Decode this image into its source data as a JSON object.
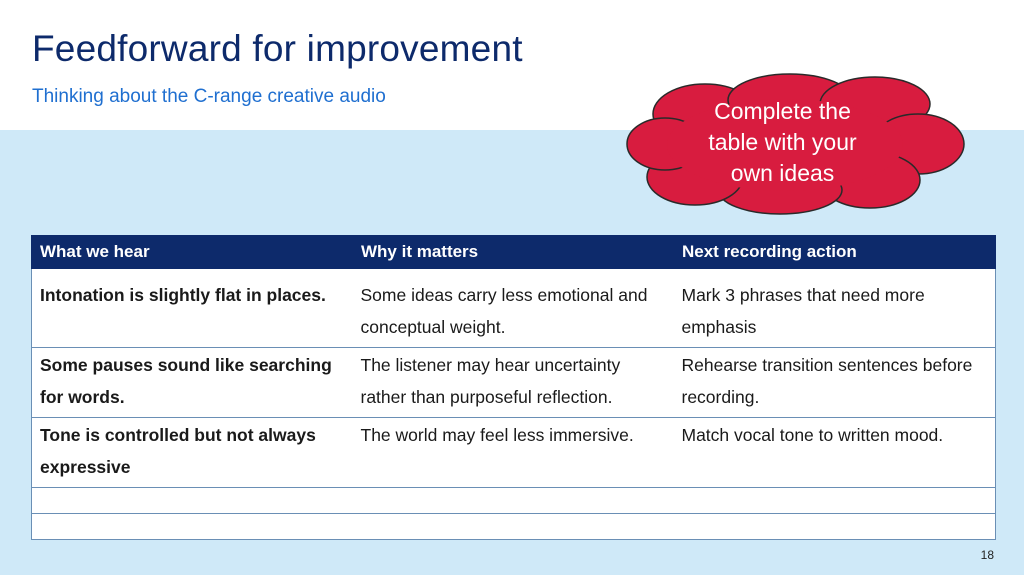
{
  "slide": {
    "title": "Feedforward for improvement",
    "subtitle": "Thinking about the C-range creative audio",
    "callout": {
      "line1": "Complete the",
      "line2": "table with your",
      "line3": "own ideas",
      "fill": "#d81c3f",
      "stroke": "#2a2a2a"
    },
    "page_number": "18"
  },
  "table": {
    "headers": [
      "What we hear",
      "Why it matters",
      "Next recording action"
    ],
    "rows": [
      [
        "Intonation is slightly flat in places.",
        "Some ideas carry less emotional and conceptual weight.",
        "Mark 3 phrases that need more emphasis"
      ],
      [
        "Some pauses sound like searching for words.",
        "The listener may hear uncertainty rather than purposeful reflection.",
        "Rehearse transition sentences before recording."
      ],
      [
        "Tone is controlled but not always expressive",
        "The world may feel less immersive.",
        "Match vocal tone to written mood."
      ],
      [
        "",
        "",
        ""
      ],
      [
        "",
        "",
        ""
      ]
    ]
  },
  "colors": {
    "title": "#0d2a6b",
    "subtitle": "#1f6fd0",
    "header_bg": "#0d2a6b",
    "band": "#cfe9f8"
  }
}
